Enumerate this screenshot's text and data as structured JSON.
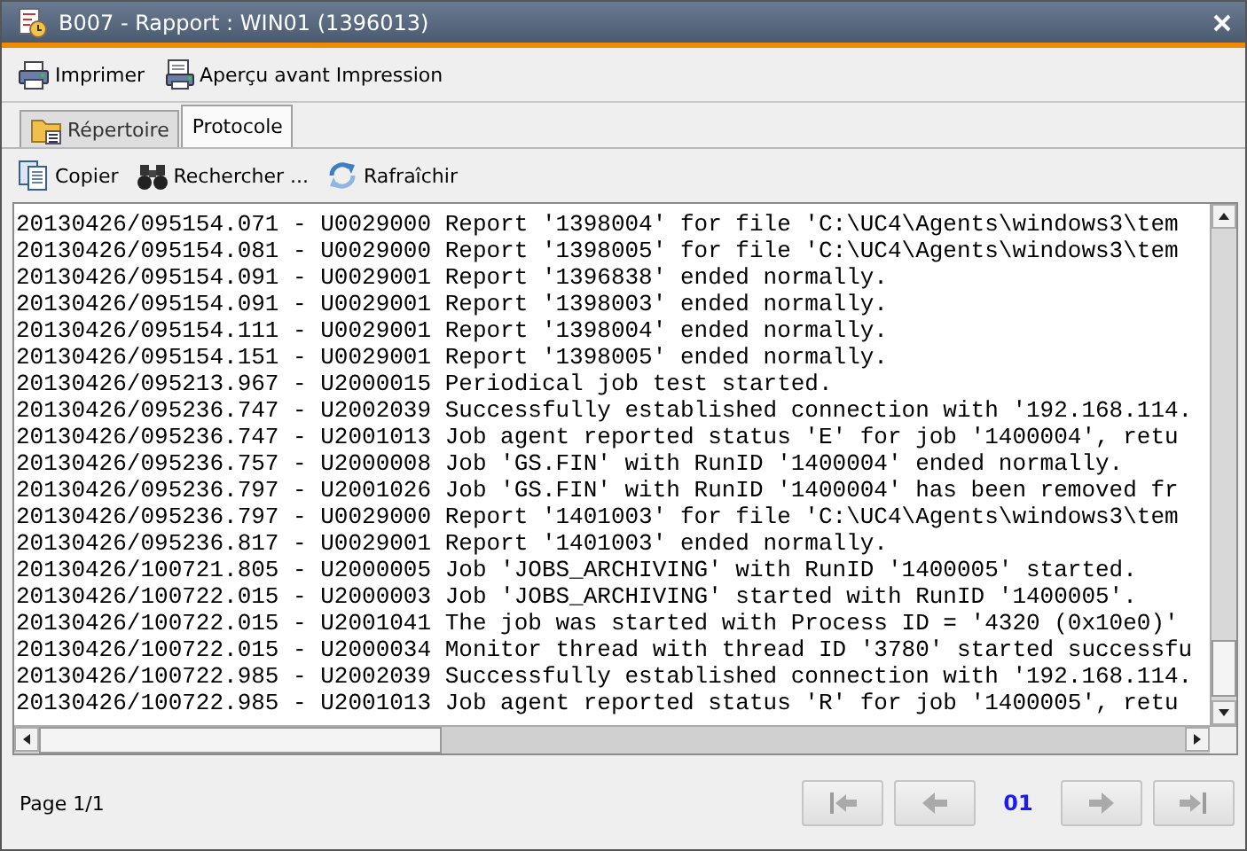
{
  "window": {
    "title": "B007 - Rapport : WIN01 (1396013)"
  },
  "toolbar": [
    {
      "kind": "print",
      "label": "Imprimer"
    },
    {
      "kind": "preview",
      "label": "Aperçu avant Impression"
    }
  ],
  "tabs": [
    {
      "kind": "folder",
      "label": "Répertoire",
      "selected": false
    },
    {
      "kind": "plain",
      "label": "Protocole",
      "selected": true
    }
  ],
  "log_toolbar": [
    {
      "kind": "copy",
      "label": "Copier"
    },
    {
      "kind": "find",
      "label": "Rechercher ..."
    },
    {
      "kind": "refresh",
      "label": "Rafraîchir"
    }
  ],
  "log_lines": [
    "20130426/095154.071 - U0029000 Report '1398004' for file 'C:\\UC4\\Agents\\windows3\\tem",
    "20130426/095154.081 - U0029000 Report '1398005' for file 'C:\\UC4\\Agents\\windows3\\tem",
    "20130426/095154.091 - U0029001 Report '1396838' ended normally.",
    "20130426/095154.091 - U0029001 Report '1398003' ended normally.",
    "20130426/095154.111 - U0029001 Report '1398004' ended normally.",
    "20130426/095154.151 - U0029001 Report '1398005' ended normally.",
    "20130426/095213.967 - U2000015 Periodical job test started.",
    "20130426/095236.747 - U2002039 Successfully established connection with '192.168.114.",
    "20130426/095236.747 - U2001013 Job agent reported status 'E' for job '1400004', retu",
    "20130426/095236.757 - U2000008 Job 'GS.FIN' with RunID '1400004' ended normally.",
    "20130426/095236.797 - U2001026 Job 'GS.FIN' with RunID '1400004' has been removed fr",
    "20130426/095236.797 - U0029000 Report '1401003' for file 'C:\\UC4\\Agents\\windows3\\tem",
    "20130426/095236.817 - U0029001 Report '1401003' ended normally.",
    "20130426/100721.805 - U2000005 Job 'JOBS_ARCHIVING' with RunID '1400005' started.",
    "20130426/100722.015 - U2000003 Job 'JOBS_ARCHIVING' started with RunID '1400005'.",
    "20130426/100722.015 - U2001041 The job was started with Process ID = '4320 (0x10e0)'",
    "20130426/100722.015 - U2000034 Monitor thread with thread ID '3780' started successfu",
    "20130426/100722.985 - U2002039 Successfully established connection with '192.168.114.",
    "20130426/100722.985 - U2001013 Job agent reported status 'R' for job '1400005', retu"
  ],
  "footer": {
    "page_label": "Page 1/1",
    "page_number": "01",
    "nav_buttons": [
      {
        "kind": "first",
        "disabled": true
      },
      {
        "kind": "prev",
        "disabled": true
      },
      {
        "kind": "next",
        "disabled": true
      },
      {
        "kind": "last",
        "disabled": true
      }
    ]
  }
}
